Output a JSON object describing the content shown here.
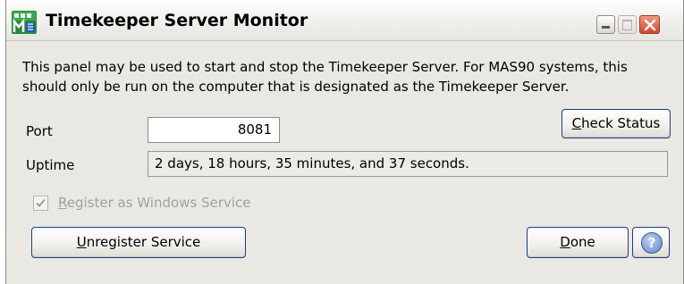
{
  "window": {
    "title": "Timekeeper Server Monitor",
    "icon": "timekeeper-app-icon"
  },
  "description": "This panel may be used to start and stop the Timekeeper Server. For MAS90 systems, this should only be run on the computer that is designated as the Timekeeper Server.",
  "port": {
    "label": "Port",
    "value": "8081"
  },
  "uptime": {
    "label": "Uptime",
    "value": "2 days, 18 hours, 35 minutes, and 37 seconds."
  },
  "check_status": {
    "accel": "C",
    "rest": "heck Status"
  },
  "register": {
    "checked": true,
    "enabled": false,
    "accel": "R",
    "rest": "egister as Windows Service"
  },
  "unregister": {
    "accel": "U",
    "rest": "nregister Service"
  },
  "done": {
    "accel": "D",
    "rest": "one"
  },
  "help": {
    "icon": "question-mark-icon",
    "glyph": "?"
  },
  "colors": {
    "accent_border": "#1f3b8f",
    "close_button": "#d2462a",
    "dialog_background": "#e9e8e2",
    "disabled_text": "#a3a199"
  }
}
